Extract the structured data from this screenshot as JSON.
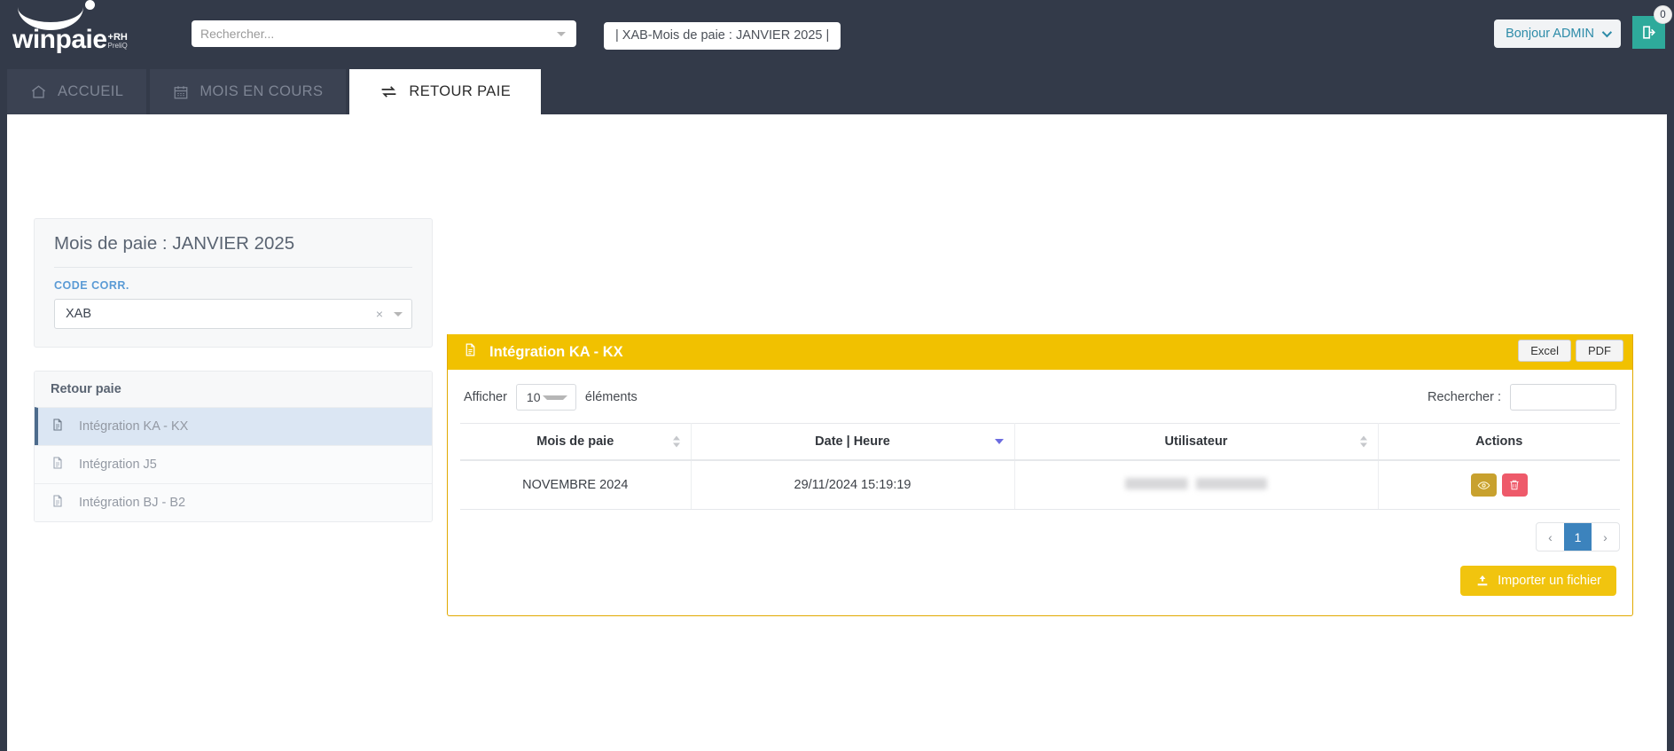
{
  "brand": {
    "name": "winpaie",
    "suffix_top": "+RH",
    "suffix_bottom": "PreliQ",
    "accent_yellow": "#f1c100",
    "accent_teal": "#2eaa9b",
    "dark_navy": "#333a49",
    "link_blue": "#2d8ba8"
  },
  "header": {
    "search_placeholder": "Rechercher...",
    "breadcrumb": "| XAB-Mois de paie : JANVIER 2025 |",
    "user_greeting": "Bonjour ADMIN",
    "notification_count": "0",
    "logout_icon": "logout-icon",
    "search_caret_icon": "caret-down-icon"
  },
  "tabs": [
    {
      "label": "ACCUEIL",
      "icon": "home-icon",
      "active": false
    },
    {
      "label": "MOIS EN COURS",
      "icon": "calendar-icon",
      "active": false
    },
    {
      "label": "RETOUR PAIE",
      "icon": "exchange-arrows-icon",
      "active": true
    }
  ],
  "sidebar": {
    "card_title": "Mois de paie : JANVIER 2025",
    "field_label": "CODE CORR.",
    "select_value": "XAB",
    "clear_icon": "clear-x-icon",
    "dropdown_icon": "caret-down-icon",
    "list_heading": "Retour paie",
    "items": [
      {
        "label": "Intégration KA - KX",
        "icon": "file-text-icon",
        "active": true
      },
      {
        "label": "Intégration J5",
        "icon": "file-text-icon",
        "active": false
      },
      {
        "label": "Intégration BJ - B2",
        "icon": "file-text-icon",
        "active": false
      }
    ]
  },
  "panel": {
    "title": "Intégration KA - KX",
    "title_icon": "file-text-icon",
    "export_excel": "Excel",
    "export_pdf": "PDF",
    "length_label_before": "Afficher",
    "length_value": "10",
    "length_label_after": "éléments",
    "search_label": "Rechercher :",
    "search_value": "",
    "table": {
      "columns": [
        {
          "label": "Mois de paie",
          "sort": "none"
        },
        {
          "label": "Date | Heure",
          "sort": "desc"
        },
        {
          "label": "Utilisateur",
          "sort": "none"
        },
        {
          "label": "Actions",
          "sort": null
        }
      ],
      "rows": [
        {
          "mois_de_paie": "NOVEMBRE 2024",
          "date_heure": "29/11/2024 15:19:19",
          "utilisateur": "",
          "actions": [
            "view-icon",
            "delete-icon"
          ]
        }
      ]
    },
    "pagination": {
      "prev": "‹",
      "pages": [
        "1"
      ],
      "current": "1",
      "next": "›"
    },
    "import_button": "Importer un fichier",
    "import_icon": "upload-icon"
  }
}
